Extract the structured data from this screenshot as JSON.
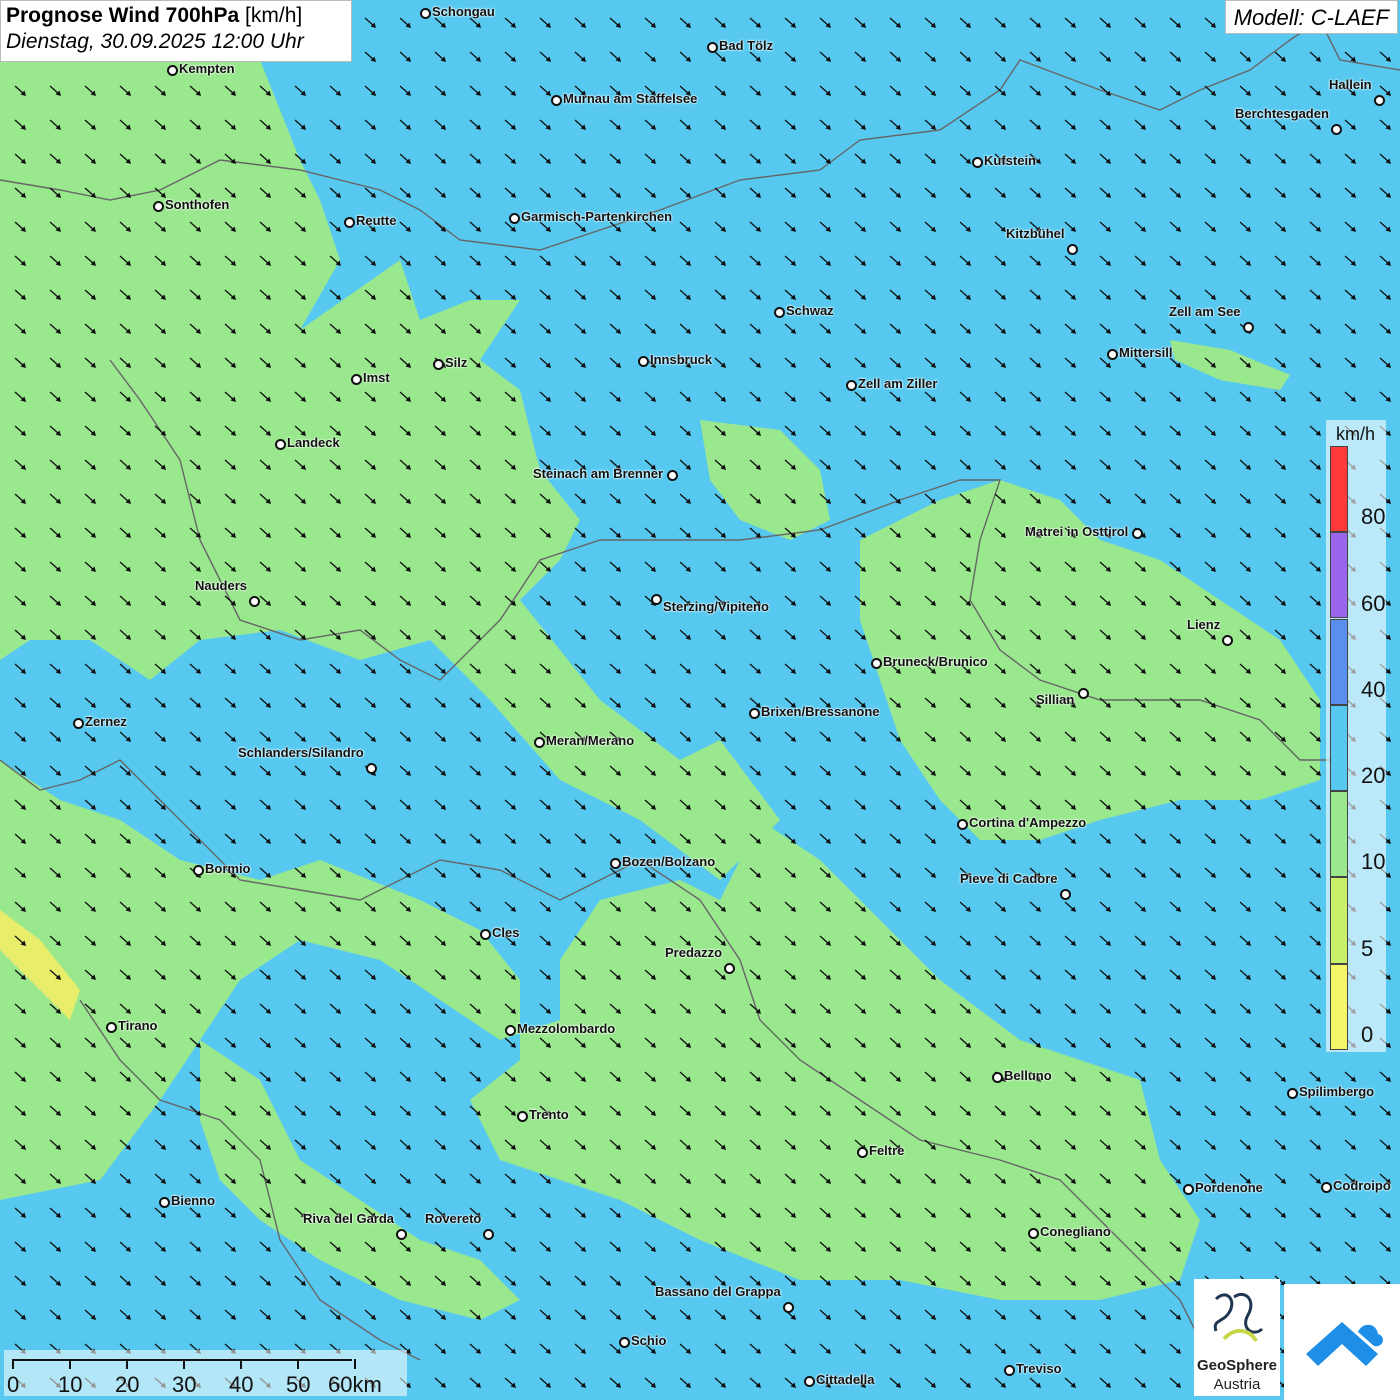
{
  "header": {
    "title_bold": "Prognose Wind 700hPa",
    "title_unit": "[km/h]",
    "datetime": "Dienstag, 30.09.2025 12:00 Uhr",
    "model": "Modell: C-LAEF"
  },
  "legend": {
    "unit": "km/h",
    "classes": [
      {
        "from": 0,
        "to": 5,
        "color": "#f5f56a"
      },
      {
        "from": 5,
        "to": 10,
        "color": "#c8f06a"
      },
      {
        "from": 10,
        "to": 20,
        "color": "#9ae88e"
      },
      {
        "from": 20,
        "to": 40,
        "color": "#57c9f0"
      },
      {
        "from": 40,
        "to": 60,
        "color": "#5a8ff0"
      },
      {
        "from": 60,
        "to": 80,
        "color": "#9a66ee"
      },
      {
        "from": 80,
        "to": 100,
        "color": "#ff3a3a"
      }
    ],
    "labels": [
      "0",
      "5",
      "10",
      "20",
      "40",
      "60",
      "80"
    ]
  },
  "scalebar": {
    "labels": [
      "0",
      "10",
      "20",
      "30",
      "40",
      "50",
      "60km"
    ]
  },
  "logos": {
    "geosphere_line1": "GeoSphere",
    "geosphere_line2": "Austria"
  },
  "wind": {
    "dominant_direction": "northwest",
    "arrow_orientation": "pointing south-east"
  },
  "cities": [
    {
      "name": "Schongau"
    },
    {
      "name": "Bad Tölz"
    },
    {
      "name": "Kempten"
    },
    {
      "name": "Murnau am Staffelsee"
    },
    {
      "name": "Hallein"
    },
    {
      "name": "Berchtesgaden"
    },
    {
      "name": "Kufstein"
    },
    {
      "name": "Sonthofen"
    },
    {
      "name": "Reutte"
    },
    {
      "name": "Garmisch-Partenkirchen"
    },
    {
      "name": "Kitzbühel"
    },
    {
      "name": "Schwaz"
    },
    {
      "name": "Zell am See"
    },
    {
      "name": "Mittersill"
    },
    {
      "name": "Innsbruck"
    },
    {
      "name": "Silz"
    },
    {
      "name": "Imst"
    },
    {
      "name": "Zell am Ziller"
    },
    {
      "name": "Landeck"
    },
    {
      "name": "Steinach am Brenner"
    },
    {
      "name": "Matrei in Osttirol"
    },
    {
      "name": "Nauders"
    },
    {
      "name": "Sterzing/Vipiteno"
    },
    {
      "name": "Lienz"
    },
    {
      "name": "Bruneck/Brunico"
    },
    {
      "name": "Sillian"
    },
    {
      "name": "Brixen/Bressanone"
    },
    {
      "name": "Zernez"
    },
    {
      "name": "Meran/Merano"
    },
    {
      "name": "Schlanders/Silandro"
    },
    {
      "name": "Cortina d'Ampezzo"
    },
    {
      "name": "Bozen/Bolzano"
    },
    {
      "name": "Bormio"
    },
    {
      "name": "Pieve di Cadore"
    },
    {
      "name": "Cles"
    },
    {
      "name": "Predazzo"
    },
    {
      "name": "Tirano"
    },
    {
      "name": "Mezzolombardo"
    },
    {
      "name": "Belluno"
    },
    {
      "name": "Spilimbergo"
    },
    {
      "name": "Trento"
    },
    {
      "name": "Feltre"
    },
    {
      "name": "Bienno"
    },
    {
      "name": "Pordenone"
    },
    {
      "name": "Codroipo"
    },
    {
      "name": "Riva del Garda"
    },
    {
      "name": "Rovereto"
    },
    {
      "name": "Conegliano"
    },
    {
      "name": "Bassano del Grappa"
    },
    {
      "name": "Schio"
    },
    {
      "name": "Treviso"
    },
    {
      "name": "Cittadella"
    }
  ]
}
